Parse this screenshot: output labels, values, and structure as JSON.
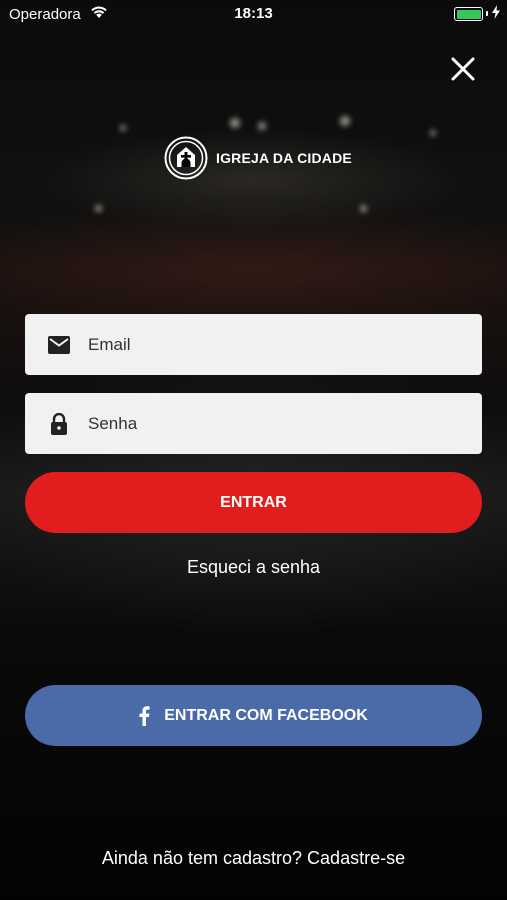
{
  "status": {
    "carrier": "Operadora",
    "time": "18:13",
    "battery_color": "#35c759"
  },
  "brand": {
    "name": "IGREJA DA CIDADE"
  },
  "form": {
    "email_placeholder": "Email",
    "password_placeholder": "Senha",
    "login_label": "ENTRAR",
    "forgot_label": "Esqueci a senha",
    "facebook_label": "ENTRAR COM FACEBOOK"
  },
  "footer": {
    "prompt": "Ainda não tem cadastro?",
    "signup_label": "Cadastre-se"
  },
  "colors": {
    "primary": "#e21d1d",
    "facebook": "#4a6aa8",
    "field_bg": "#f1f1f1"
  },
  "icons": [
    "close-icon",
    "logo-icon",
    "mail-icon",
    "lock-icon",
    "facebook-icon",
    "wifi-icon",
    "bolt-icon"
  ]
}
